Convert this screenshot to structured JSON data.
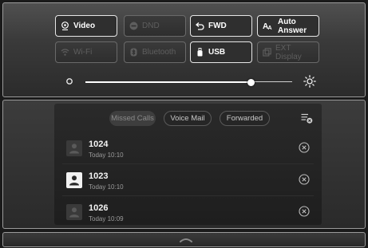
{
  "quick_settings": {
    "buttons": [
      {
        "label": "Video",
        "icon": "video-icon",
        "state": "on"
      },
      {
        "label": "DND",
        "icon": "dnd-icon",
        "state": "off"
      },
      {
        "label": "FWD",
        "icon": "forward-icon",
        "state": "on"
      },
      {
        "label": "Auto Answer",
        "icon": "auto-answer-icon",
        "state": "on"
      },
      {
        "label": "Wi-Fi",
        "icon": "wifi-icon",
        "state": "off"
      },
      {
        "label": "Bluetooth",
        "icon": "bluetooth-icon",
        "state": "off"
      },
      {
        "label": "USB",
        "icon": "usb-icon",
        "state": "on"
      },
      {
        "label": "EXT Display",
        "icon": "ext-display-icon",
        "state": "off"
      }
    ],
    "brightness": {
      "level": 0.8
    }
  },
  "calls": {
    "tabs": [
      {
        "label": "Missed Calls",
        "active": true
      },
      {
        "label": "Voice Mail",
        "active": false
      },
      {
        "label": "Forwarded",
        "active": false
      }
    ],
    "items": [
      {
        "number": "1024",
        "time": "Today 10:10",
        "highlighted": false
      },
      {
        "number": "1023",
        "time": "Today 10:10",
        "highlighted": true
      },
      {
        "number": "1026",
        "time": "Today 10:09",
        "highlighted": false
      }
    ]
  },
  "colors": {
    "active": "#ffffff",
    "inactive": "#5e5e5e",
    "panel_border": "#9a9a9a"
  }
}
